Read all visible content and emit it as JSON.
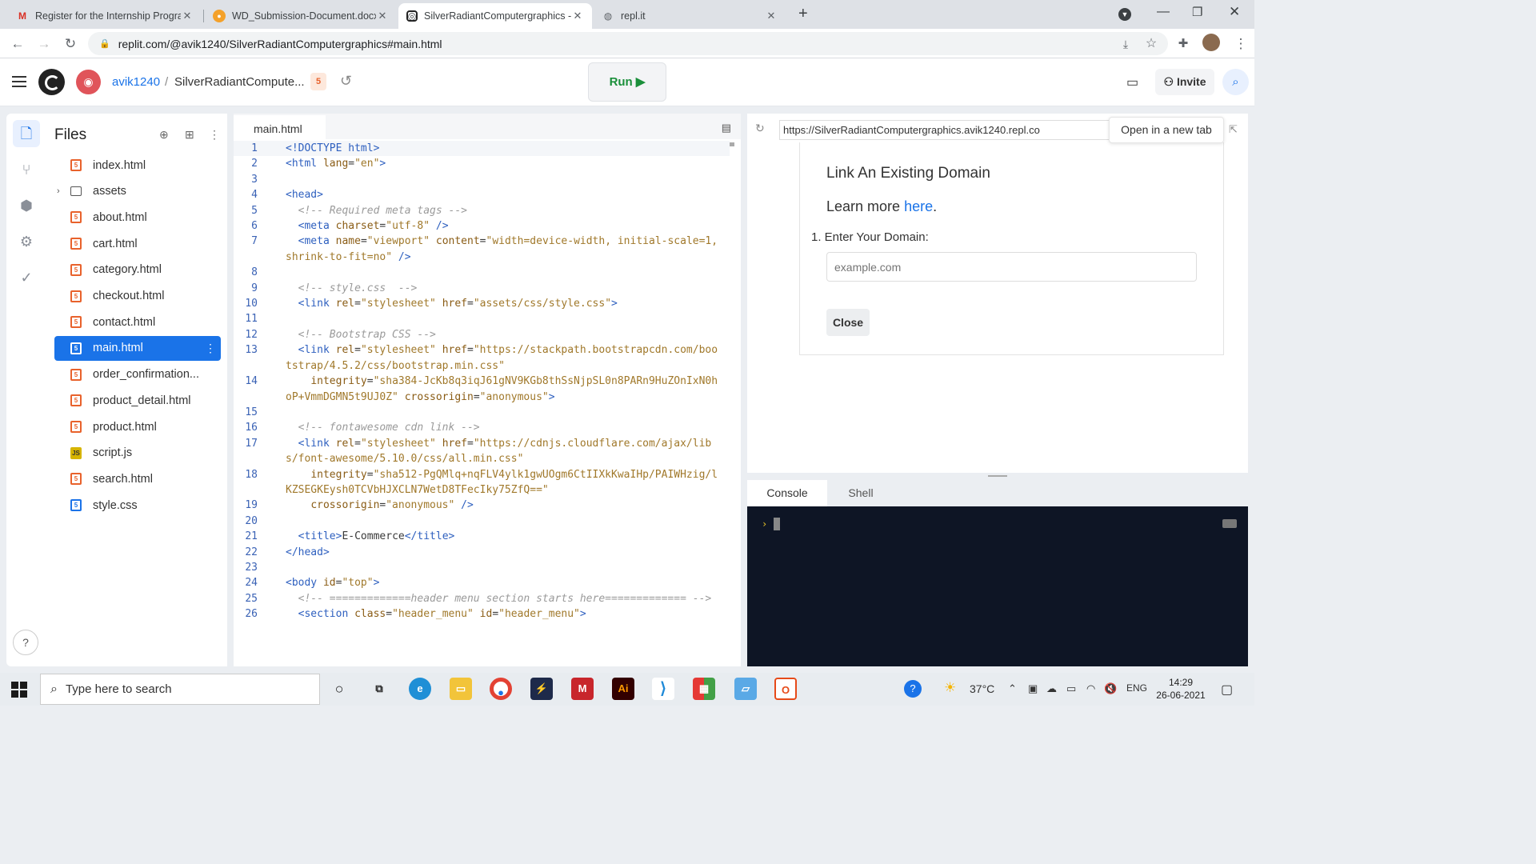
{
  "browser": {
    "tabs": [
      {
        "title": "Register for the Internship Progra",
        "icon": "gmail-icon"
      },
      {
        "title": "WD_Submission-Document.docx",
        "icon": "docx-icon"
      },
      {
        "title": "SilverRadiantComputergraphics -",
        "icon": "replit-icon"
      },
      {
        "title": "repl.it",
        "icon": "globe-icon"
      }
    ],
    "url": "replit.com/@avik1240/SilverRadiantComputergraphics#main.html"
  },
  "header": {
    "username": "avik1240",
    "separator": "/",
    "repl_name": "SilverRadiantCompute...",
    "lang_badge": "5",
    "run_label": "Run ▶",
    "invite_label": "Invite"
  },
  "files": {
    "title": "Files",
    "items": [
      {
        "name": "index.html",
        "type": "html"
      },
      {
        "name": "assets",
        "type": "folder"
      },
      {
        "name": "about.html",
        "type": "html"
      },
      {
        "name": "cart.html",
        "type": "html"
      },
      {
        "name": "category.html",
        "type": "html"
      },
      {
        "name": "checkout.html",
        "type": "html"
      },
      {
        "name": "contact.html",
        "type": "html"
      },
      {
        "name": "main.html",
        "type": "html",
        "selected": true
      },
      {
        "name": "order_confirmation...",
        "type": "html"
      },
      {
        "name": "product_detail.html",
        "type": "html"
      },
      {
        "name": "product.html",
        "type": "html"
      },
      {
        "name": "script.js",
        "type": "js"
      },
      {
        "name": "search.html",
        "type": "html"
      },
      {
        "name": "style.css",
        "type": "css"
      }
    ]
  },
  "editor": {
    "tab": "main.html",
    "lines": [
      {
        "n": "1",
        "html": "<span class=\"t\">&lt;!DOCTYPE html&gt;</span>"
      },
      {
        "n": "2",
        "html": "<span class=\"t\">&lt;html</span> <span class=\"a\">lang</span>=<span class=\"s\">\"en\"</span><span class=\"t\">&gt;</span>"
      },
      {
        "n": "3",
        "html": ""
      },
      {
        "n": "4",
        "html": "<span class=\"t\">&lt;head&gt;</span>"
      },
      {
        "n": "5",
        "html": "  <span class=\"c\">&lt;!-- Required meta tags --&gt;</span>"
      },
      {
        "n": "6",
        "html": "  <span class=\"t\">&lt;meta</span> <span class=\"a\">charset</span>=<span class=\"s\">\"utf-8\"</span> <span class=\"t\">/&gt;</span>"
      },
      {
        "n": "7",
        "html": "  <span class=\"t\">&lt;meta</span> <span class=\"a\">name</span>=<span class=\"s\">\"viewport\"</span> <span class=\"a\">content</span>=<span class=\"s\">\"width=device-width, initial-scale=1, shrink-to-fit=no\"</span> <span class=\"t\">/&gt;</span>"
      },
      {
        "n": "8",
        "html": ""
      },
      {
        "n": "9",
        "html": "  <span class=\"c\">&lt;!-- style.css  --&gt;</span>"
      },
      {
        "n": "10",
        "html": "  <span class=\"t\">&lt;link</span> <span class=\"a\">rel</span>=<span class=\"s\">\"stylesheet\"</span> <span class=\"a\">href</span>=<span class=\"s\">\"assets/css/style.css\"</span><span class=\"t\">&gt;</span>"
      },
      {
        "n": "11",
        "html": ""
      },
      {
        "n": "12",
        "html": "  <span class=\"c\">&lt;!-- Bootstrap CSS --&gt;</span>"
      },
      {
        "n": "13",
        "html": "  <span class=\"t\">&lt;link</span> <span class=\"a\">rel</span>=<span class=\"s\">\"stylesheet\"</span> <span class=\"a\">href</span>=<span class=\"s\">\"https://stackpath.bootstrapcdn.com/bootstrap/4.5.2/css/bootstrap.min.css\"</span>"
      },
      {
        "n": "14",
        "html": "    <span class=\"a\">integrity</span>=<span class=\"s\">\"sha384-JcKb8q3iqJ61gNV9KGb8thSsNjpSL0n8PARn9HuZOnIxN0hoP+VmmDGMN5t9UJ0Z\"</span> <span class=\"a\">crossorigin</span>=<span class=\"s\">\"anonymous\"</span><span class=\"t\">&gt;</span>"
      },
      {
        "n": "15",
        "html": ""
      },
      {
        "n": "16",
        "html": "  <span class=\"c\">&lt;!-- fontawesome cdn link --&gt;</span>"
      },
      {
        "n": "17",
        "html": "  <span class=\"t\">&lt;link</span> <span class=\"a\">rel</span>=<span class=\"s\">\"stylesheet\"</span> <span class=\"a\">href</span>=<span class=\"s\">\"https://cdnjs.cloudflare.com/ajax/libs/font-awesome/5.10.0/css/all.min.css\"</span>"
      },
      {
        "n": "18",
        "html": "    <span class=\"a\">integrity</span>=<span class=\"s\">\"sha512-PgQMlq+nqFLV4ylk1gwUOgm6CtIIXkKwaIHp/PAIWHzig/lKZSEGKEysh0TCVbHJXCLN7WetD8TFecIky75ZfQ==\"</span>"
      },
      {
        "n": "19",
        "html": "    <span class=\"a\">crossorigin</span>=<span class=\"s\">\"anonymous\"</span> <span class=\"t\">/&gt;</span>"
      },
      {
        "n": "20",
        "html": ""
      },
      {
        "n": "21",
        "html": "  <span class=\"t\">&lt;title&gt;</span>E-Commerce<span class=\"t\">&lt;/title&gt;</span>"
      },
      {
        "n": "22",
        "html": "<span class=\"t\">&lt;/head&gt;</span>"
      },
      {
        "n": "23",
        "html": ""
      },
      {
        "n": "24",
        "html": "<span class=\"t\">&lt;body</span> <span class=\"a\">id</span>=<span class=\"s\">\"top\"</span><span class=\"t\">&gt;</span>"
      },
      {
        "n": "25",
        "html": "  <span class=\"c\">&lt;!-- =============header menu section starts here============= --&gt;</span>"
      },
      {
        "n": "26",
        "html": "  <span class=\"t\">&lt;section</span> <span class=\"a\">class</span>=<span class=\"s\">\"header_menu\"</span> <span class=\"a\">id</span>=<span class=\"s\">\"header_menu\"</span><span class=\"t\">&gt;</span>"
      }
    ]
  },
  "webview": {
    "url": "https://SilverRadiantComputergraphics.avik1240.repl.co",
    "open_new_tab": "Open in a new tab",
    "modal": {
      "title": "Link An Existing Domain",
      "learn_prefix": "Learn more ",
      "learn_link": "here",
      "learn_suffix": ".",
      "step": "1. Enter Your Domain:",
      "input_placeholder": "example.com",
      "close_label": "Close"
    }
  },
  "console": {
    "tabs": [
      "Console",
      "Shell"
    ],
    "prompt": "›"
  },
  "taskbar": {
    "search_placeholder": "Type here to search",
    "temperature": "37°C",
    "lang": "ENG",
    "time": "14:29",
    "date": "26-06-2021"
  },
  "colors": {
    "accent": "#1a73e8",
    "run_green": "#1a8f3a",
    "console_bg": "#0e1525"
  }
}
